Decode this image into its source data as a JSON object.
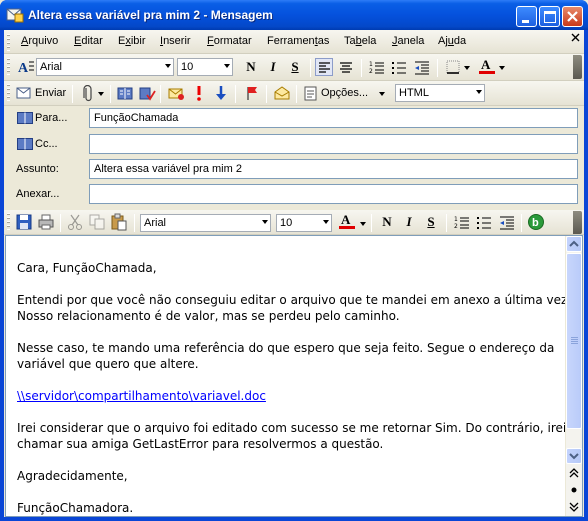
{
  "window": {
    "title": "Altera essa variável pra mim 2 - Mensagem"
  },
  "menu": {
    "items": [
      {
        "pre": "",
        "key": "A",
        "post": "rquivo"
      },
      {
        "pre": "",
        "key": "E",
        "post": "ditar"
      },
      {
        "pre": "E",
        "key": "x",
        "post": "ibir"
      },
      {
        "pre": "",
        "key": "I",
        "post": "nserir"
      },
      {
        "pre": "",
        "key": "F",
        "post": "ormatar"
      },
      {
        "pre": "Ferramen",
        "key": "t",
        "post": "as"
      },
      {
        "pre": "Ta",
        "key": "b",
        "post": "ela"
      },
      {
        "pre": "",
        "key": "J",
        "post": "anela"
      },
      {
        "pre": "Aj",
        "key": "u",
        "post": "da"
      }
    ]
  },
  "format_toolbar": {
    "font": "Arial",
    "size": "10",
    "bold": "N",
    "italic": "I",
    "underline": "S",
    "font_color": "#e00000",
    "icons": [
      "style-icon",
      "align-left-icon",
      "center-icon",
      "numbered-list-icon",
      "bullet-list-icon",
      "decrease-indent-icon",
      "border-icon",
      "font-color-icon"
    ]
  },
  "send_toolbar": {
    "send_label": "Enviar",
    "options_label": "Opções...",
    "format_value": "HTML",
    "icons": [
      "attach-icon",
      "address-book-icon",
      "check-names-icon",
      "options-envelope-icon",
      "importance-high-icon",
      "importance-low-icon",
      "flag-icon",
      "envelope-open-icon"
    ]
  },
  "header_fields": {
    "to_label": "Para...",
    "to_value": "FunçãoChamada",
    "cc_label": "Cc...",
    "cc_value": "",
    "subject_label": "Assunto:",
    "subject_value": "Altera essa variável pra mim 2",
    "attach_label": "Anexar...",
    "attach_value": ""
  },
  "edit_toolbar": {
    "font": "Arial",
    "size": "10",
    "bold": "N",
    "italic": "I",
    "underline": "S",
    "font_color": "#e00000"
  },
  "message": {
    "greeting": "Cara, FunçãoChamada,",
    "para1_line1": "Entendi por que você não conseguiu editar o arquivo que te mandei em anexo a última vez.",
    "para1_line2": "Nosso relacionamento é de valor, mas se perdeu pelo caminho.",
    "para2_line1": "Nesse caso, te mando uma referência do que espero que seja feito. Segue o endereço da",
    "para2_line2": "variável que quero que altere.",
    "link": "\\\\servidor\\compartilhamento\\variavel.doc",
    "para3_line1": "Irei considerar que o arquivo foi editado com sucesso se me retornar Sim. Do contrário, irei",
    "para3_line2": "chamar sua amiga GetLastError para resolvermos a questão.",
    "closing": "Agradecidamente,",
    "signature": "FunçãoChamadora."
  }
}
